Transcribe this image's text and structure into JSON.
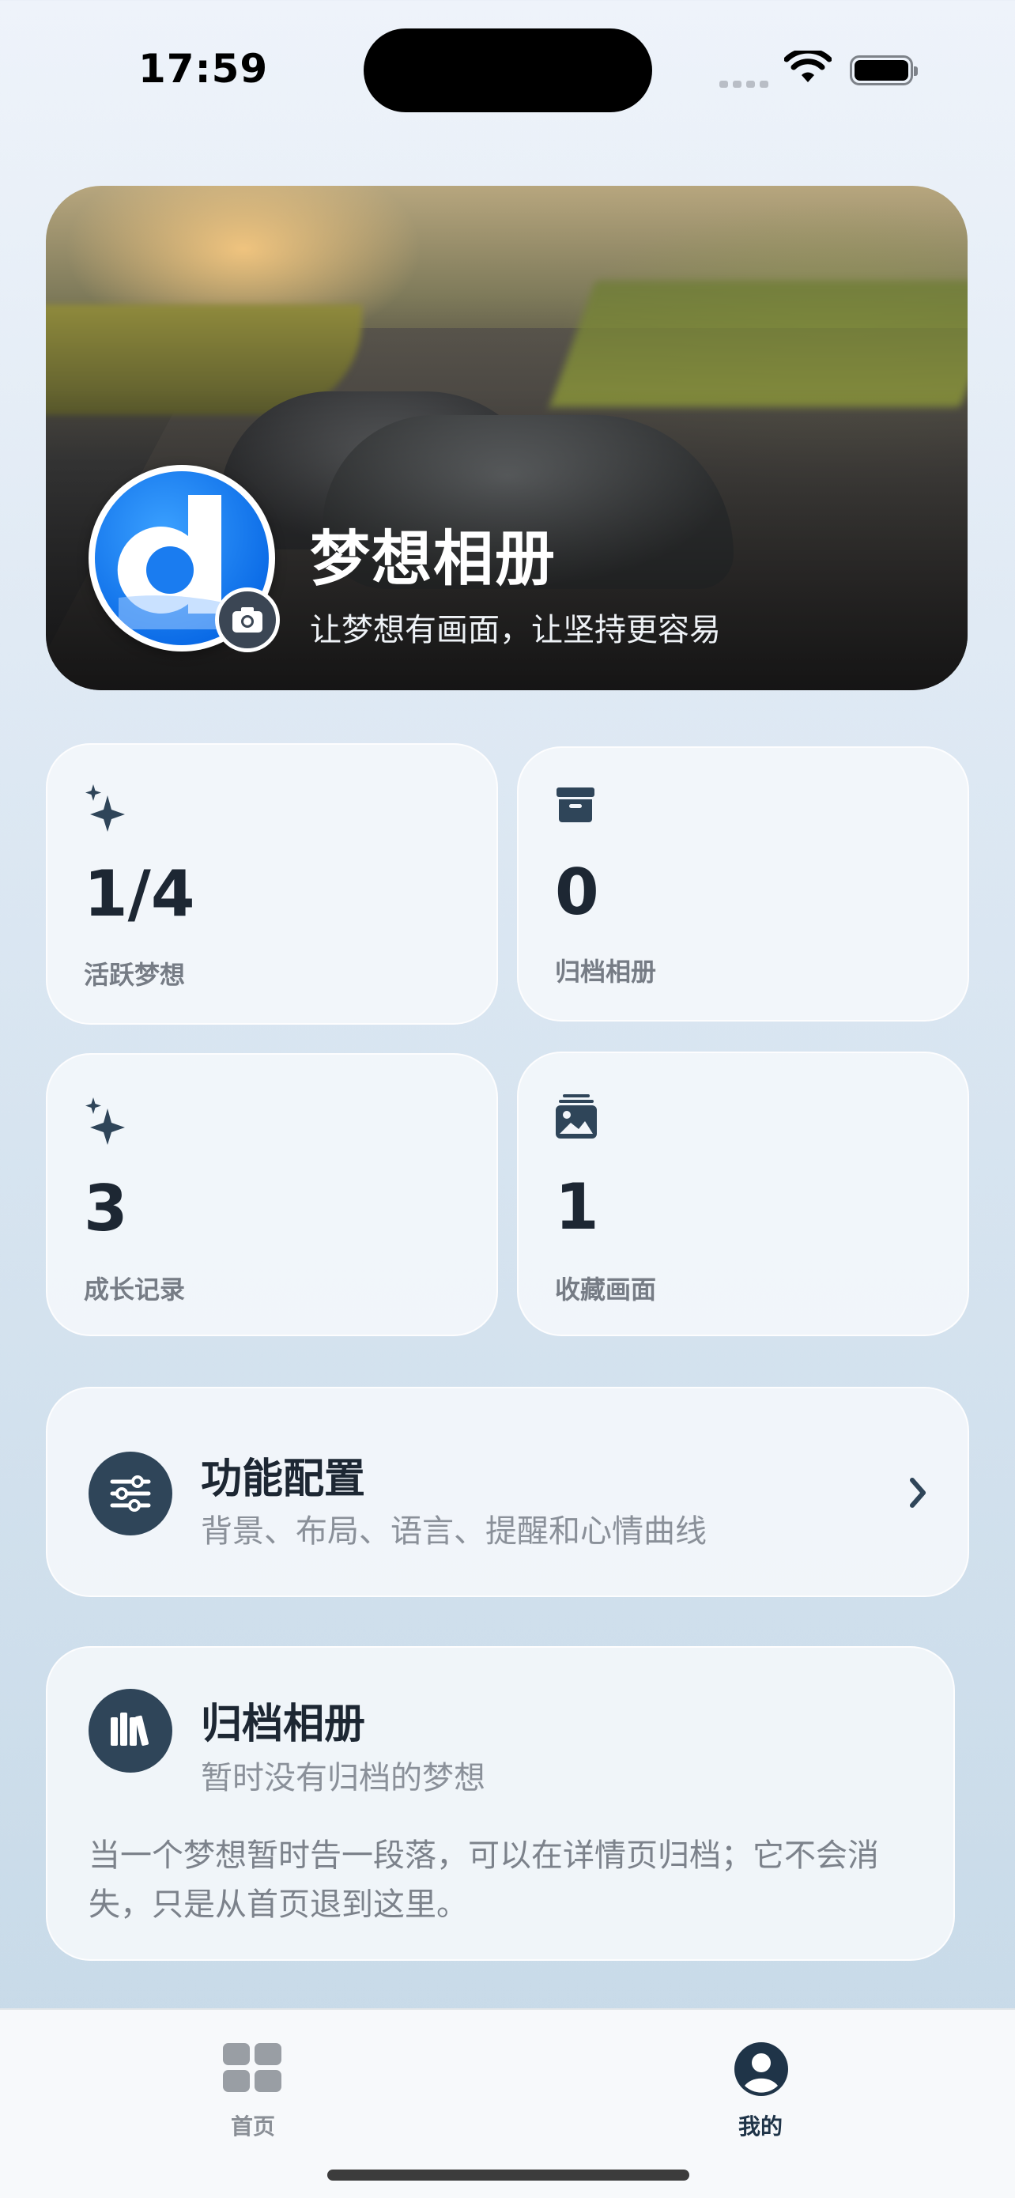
{
  "status_bar": {
    "time": "17:59"
  },
  "hero": {
    "title": "梦想相册",
    "subtitle": "让梦想有画面，让坚持更容易"
  },
  "stats": [
    {
      "icon": "sparkles-icon",
      "value": "1/4",
      "label": "活跃梦想"
    },
    {
      "icon": "archive-box-icon",
      "value": "0",
      "label": "归档相册"
    },
    {
      "icon": "sparkles-icon",
      "value": "3",
      "label": "成长记录"
    },
    {
      "icon": "photo-stack-icon",
      "value": "1",
      "label": "收藏画面"
    }
  ],
  "settings_row": {
    "icon": "sliders-icon",
    "title": "功能配置",
    "subtitle": "背景、布局、语言、提醒和心情曲线"
  },
  "archive_card": {
    "icon": "books-icon",
    "title": "归档相册",
    "subtitle": "暂时没有归档的梦想",
    "description": "当一个梦想暂时告一段落，可以在详情页归档；它不会消失，只是从首页退到这里。"
  },
  "tab_bar": {
    "tabs": [
      {
        "icon": "grid-icon",
        "label": "首页",
        "selected": false
      },
      {
        "icon": "person-circle-icon",
        "label": "我的",
        "selected": true
      }
    ]
  },
  "colors": {
    "accent": "#2f4559",
    "hero_avatar": "#0a6ae6"
  }
}
